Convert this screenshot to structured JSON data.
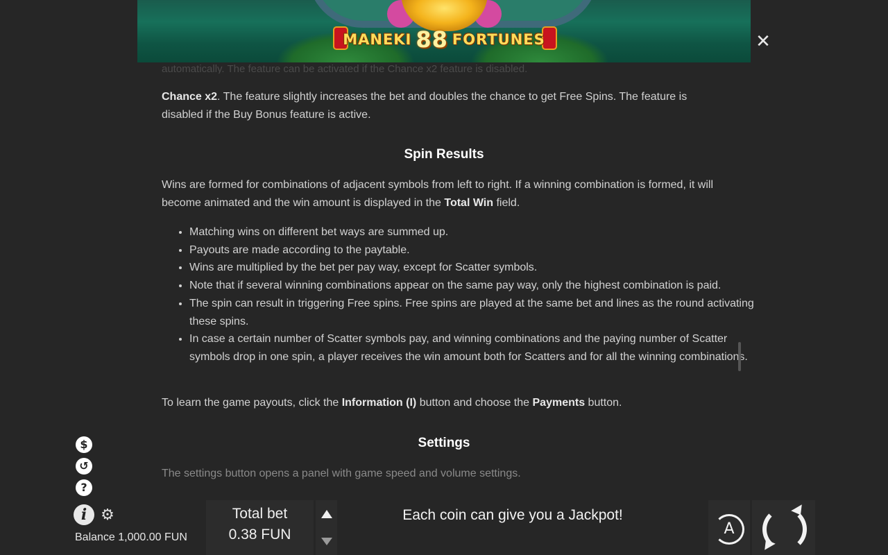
{
  "banner": {
    "logo_left": "MANEKI",
    "logo_number": "88",
    "logo_right": "FORTUNES"
  },
  "close_glyph": "✕",
  "content": {
    "cut_text": "automatically. The feature can be activated if the Chance x2 feature is disabled.",
    "chance": {
      "bold": "Chance x2",
      "text": ". The feature slightly increases the bet and doubles the chance to get Free Spins. The feature is disabled if the Buy Bonus feature is active."
    },
    "spin_results_heading": "Spin Results",
    "wins_intro": {
      "text1": "Wins are formed for combinations of adjacent symbols from left to right. If a winning combination is formed, it will become animated and the win amount is displayed in the ",
      "bold": "Total Win",
      "text2": " field."
    },
    "rules": [
      "Matching wins on different bet ways are summed up.",
      "Payouts are made according to the paytable.",
      "Wins are multiplied by the bet per pay way, except for Scatter symbols.",
      "Note that if several winning combinations appear on the same pay way, only the highest combination is paid.",
      "The spin can result in triggering Free spins. Free spins are played at the same bet and lines as the round activating these spins.",
      "In case a certain number of Scatter symbols pay, and winning combinations and the paying number of Scatter symbols drop in one spin, a player receives the win amount both for Scatters and for all the winning combinations."
    ],
    "payouts": {
      "text1": "To learn the game payouts, click the ",
      "bold1": "Information (I)",
      "text2": " button and choose the ",
      "bold2": "Payments",
      "text3": " button."
    },
    "settings_heading": "Settings",
    "settings_text": "The settings button opens a panel with game speed and volume settings."
  },
  "side_icons": {
    "coin_glyph": "$",
    "history_glyph": "↺",
    "help_glyph": "?",
    "info_glyph": "i",
    "gear_glyph": "⚙"
  },
  "balance": {
    "label": "Balance",
    "value": "1,000.00 FUN"
  },
  "bet": {
    "label": "Total bet",
    "value": "0.38 FUN"
  },
  "message": "Each coin can give you a Jackpot!",
  "autoplay_glyph": "A"
}
